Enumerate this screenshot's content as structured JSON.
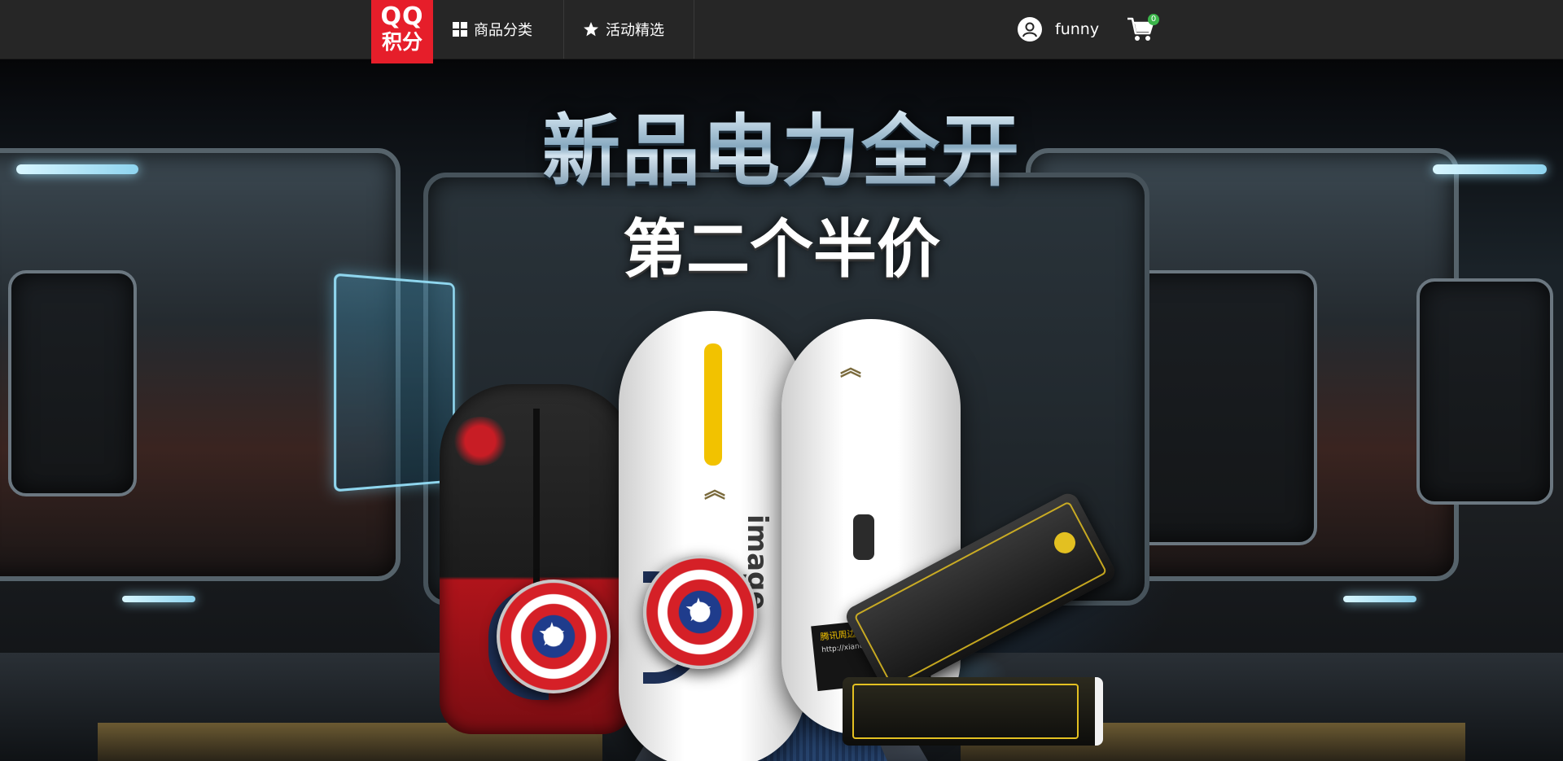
{
  "header": {
    "logo_line1": "QQ",
    "logo_line2": "积分",
    "nav": [
      {
        "label": "商品分类",
        "icon": "grid-icon"
      },
      {
        "label": "活动精选",
        "icon": "star-icon"
      }
    ],
    "username": "funny",
    "cart_count": "0"
  },
  "banner": {
    "headline": "新品电力全开",
    "subline": "第二个半价",
    "mouse_brand": "image",
    "card_title": "腾讯周边官方旗舰店：",
    "card_url": "http://xianchengtp.jd.com"
  },
  "colors": {
    "nav_bg": "#262626",
    "logo_red": "#e61e2a",
    "badge_green": "#3bb54a",
    "accent_yellow": "#f2c200"
  }
}
